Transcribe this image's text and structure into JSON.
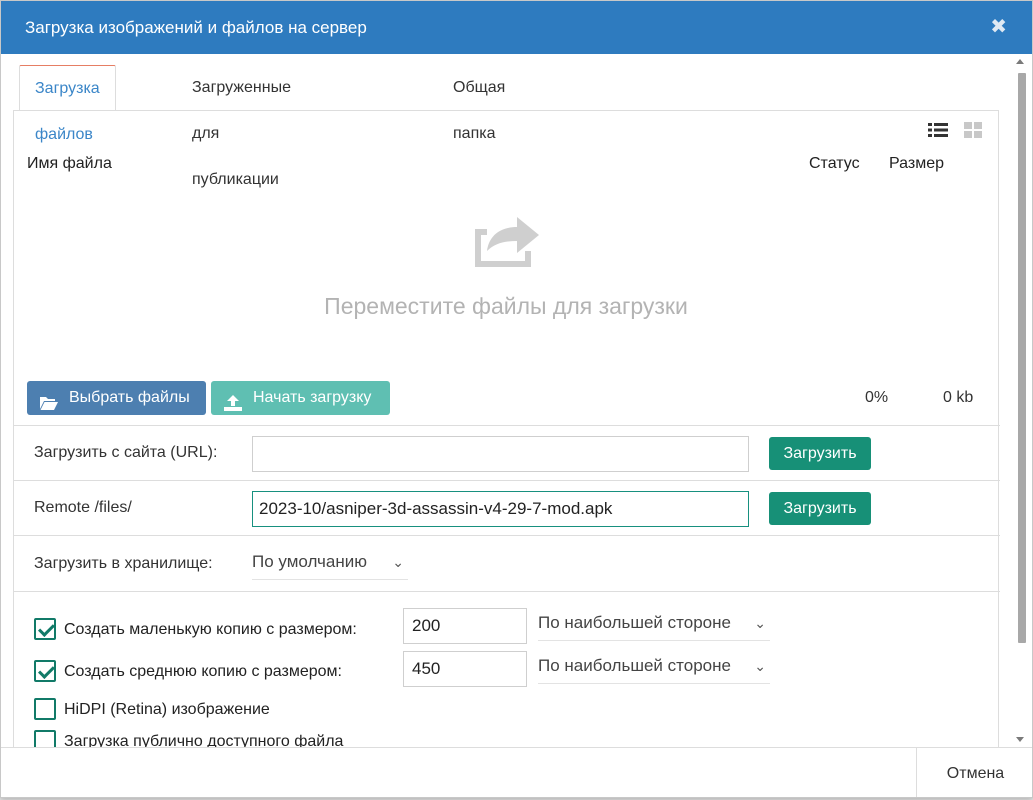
{
  "window": {
    "title": "Загрузка изображений и файлов на сервер",
    "close_label": "✖"
  },
  "tabs": [
    {
      "label": "Загрузка файлов",
      "active": true
    },
    {
      "label": "Загруженные для публикации",
      "active": false
    },
    {
      "label": "Общая папка",
      "active": false
    }
  ],
  "file_list": {
    "col_name": "Имя файла",
    "col_status": "Статус",
    "col_size": "Размер",
    "drop_text": "Переместите файлы для загрузки",
    "view_icons": [
      "list-view-icon",
      "grid-view-icon"
    ]
  },
  "actions": {
    "select_files": "Выбрать файлы",
    "start_upload": "Начать загрузку",
    "progress": "0%",
    "total_size": "0 kb"
  },
  "url_upload": {
    "label": "Загрузить с сайта (URL):",
    "value": "",
    "button": "Загрузить"
  },
  "remote_upload": {
    "label": "Remote /files/",
    "value": "2023-10/asniper-3d-assassin-v4-29-7-mod.apk",
    "button": "Загрузить"
  },
  "storage": {
    "label": "Загрузить в хранилище:",
    "selected": "По умолчанию"
  },
  "options": {
    "small_copy": {
      "label": "Создать маленькую копию с размером:",
      "checked": true,
      "size": "200",
      "mode": "По наибольшей стороне"
    },
    "medium_copy": {
      "label": "Создать среднюю копию с размером:",
      "checked": true,
      "size": "450",
      "mode": "По наибольшей стороне"
    },
    "hidpi": {
      "label": "HiDPI (Retina) изображение",
      "checked": false
    },
    "public_file": {
      "label": "Загрузка публично доступного файла",
      "checked": false
    }
  },
  "footer": {
    "cancel": "Отмена"
  },
  "colors": {
    "titlebar": "#2e7bbf",
    "select_button": "#4d7fb0",
    "start_button": "#5fbfb2",
    "green_button": "#179077",
    "active_tab_text": "#3b86c8"
  }
}
